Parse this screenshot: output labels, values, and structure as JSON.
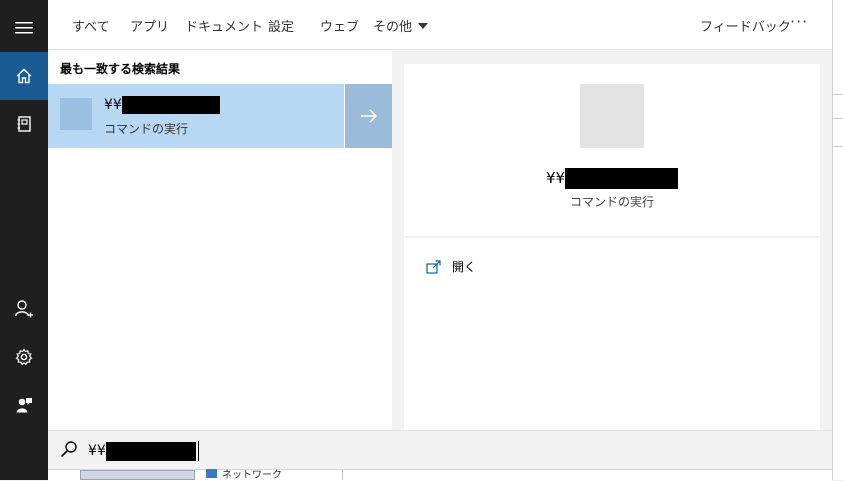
{
  "tabs": [
    {
      "label": "すべて"
    },
    {
      "label": "アプリ"
    },
    {
      "label": "ドキュメント"
    },
    {
      "label": "設定"
    },
    {
      "label": "ウェブ"
    },
    {
      "label": "その他"
    }
  ],
  "topbar": {
    "feedback_label": "フィードバック",
    "more_label": "···"
  },
  "results": {
    "section_heading": "最も一致する検索結果",
    "best_match": {
      "title_prefix": "¥¥",
      "subtitle": "コマンドの実行"
    }
  },
  "preview": {
    "title_prefix": "¥¥",
    "subtitle": "コマンドの実行",
    "open_label": "開く"
  },
  "search": {
    "query_prefix": "¥¥"
  },
  "background": {
    "network_item": "ネットワーク"
  },
  "icons": {
    "rail": [
      "hamburger-menu-icon",
      "home-icon",
      "notebook-icon",
      "user-add-icon",
      "gear-icon",
      "feedback-person-icon"
    ],
    "search": "search-icon",
    "arrow": "arrow-right-icon",
    "open": "open-external-icon"
  },
  "colors": {
    "rail_bg": "#1f1f1f",
    "rail_active": "#1b5b93",
    "selection": "#b7d7f2",
    "accent": "#0063b1"
  }
}
